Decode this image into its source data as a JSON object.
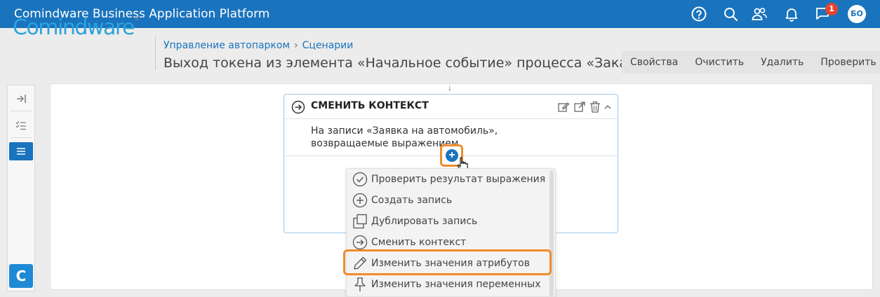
{
  "app": {
    "title": "Comindware Business Application Platform"
  },
  "topbar": {
    "icons": [
      "help-icon",
      "search-icon",
      "users-icon",
      "bell-icon",
      "chat-icon"
    ],
    "notification_count": "1",
    "avatar_initials": "БО"
  },
  "header": {
    "logo_text": "Comindware",
    "breadcrumb": [
      "Управление автопарком",
      "Сценарии"
    ],
    "title": "Выход токена из элемента «Начальное событие» процесса «Заказ а...",
    "actions": [
      "Свойства",
      "Очистить",
      "Удалить",
      "Проверить"
    ]
  },
  "left_toolbar": {
    "buttons": [
      "collapse-icon",
      "checklist-icon",
      "list-icon"
    ],
    "active": "list-icon",
    "bottom_button": "C"
  },
  "card": {
    "title": "СМЕНИТЬ КОНТЕКСТ",
    "description": "На записи «Заявка на автомобиль», возвращаемые выражением",
    "header_icons": [
      "edit-icon",
      "open-external-icon",
      "trash-icon",
      "chevron-up-icon"
    ]
  },
  "menu": {
    "items": [
      {
        "label": "Проверить результат выражения",
        "icon": "check-circle-icon"
      },
      {
        "label": "Создать запись",
        "icon": "plus-circle-icon"
      },
      {
        "label": "Дублировать запись",
        "icon": "copy-icon"
      },
      {
        "label": "Сменить контекст",
        "icon": "arrow-circle-icon"
      },
      {
        "label": "Изменить значения атрибутов",
        "icon": "pencil-icon"
      },
      {
        "label": "Изменить значения переменных",
        "icon": "pin-icon"
      }
    ],
    "highlighted_index": 4
  },
  "colors": {
    "primary": "#1a73bd",
    "highlight": "#ef8c2a",
    "badge": "#e2452f",
    "logo": "#2aa3dc"
  }
}
